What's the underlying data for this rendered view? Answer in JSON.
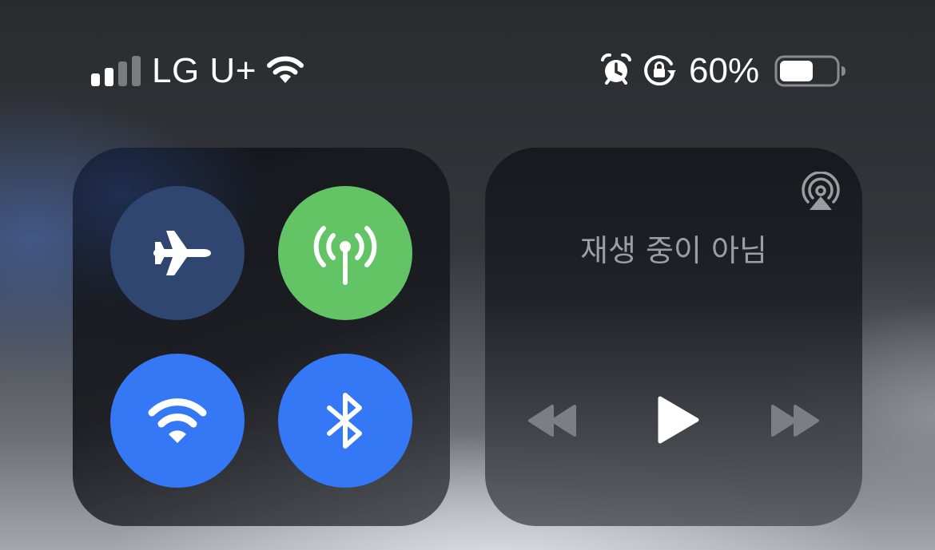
{
  "status_bar": {
    "carrier": "LG U+",
    "signal_bars_active": 2,
    "signal_bars_total": 4,
    "battery_text": "60%",
    "battery_level": 0.6,
    "icons": [
      "signal-icon",
      "wifi-icon",
      "alarm-icon",
      "orientation-lock-icon",
      "battery-icon"
    ]
  },
  "connectivity": {
    "airplane": {
      "icon": "airplane-icon",
      "on": false,
      "color": "#2f4670"
    },
    "cellular": {
      "icon": "antenna-icon",
      "on": true,
      "color": "#62c464"
    },
    "wifi": {
      "icon": "wifi-icon",
      "on": true,
      "color": "#3478f6"
    },
    "bluetooth": {
      "icon": "bluetooth-icon",
      "on": true,
      "color": "#3478f6"
    }
  },
  "media": {
    "status_text": "재생 중이 아님",
    "controls": [
      "rewind-icon",
      "play-icon",
      "fast-forward-icon"
    ],
    "airplay_icon": "airplay-icon"
  }
}
